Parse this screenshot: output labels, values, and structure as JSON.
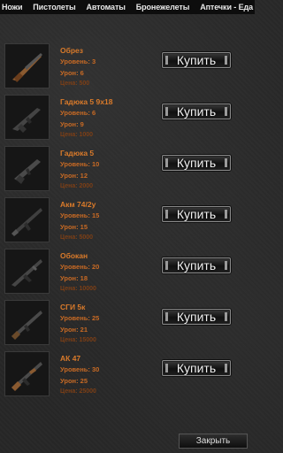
{
  "tabs": [
    "Ножи",
    "Пистолеты",
    "Автоматы",
    "Бронежелеты",
    "Аптечки - Еда"
  ],
  "buy_label": "Купить",
  "close_label": "Закрыть",
  "items": [
    {
      "name": "Обрез",
      "level": "Уровень: 3",
      "damage": "Урон: 6",
      "price": "Цена: 500"
    },
    {
      "name": "Гадюка 5 9х18",
      "level": "Уровень: 6",
      "damage": "Урон: 9",
      "price": "Цена: 1000"
    },
    {
      "name": "Гадюка 5",
      "level": "Уровень: 10",
      "damage": "Урон: 12",
      "price": "Цена: 2000"
    },
    {
      "name": "Акм 74/2у",
      "level": "Уровень: 15",
      "damage": "Урон: 15",
      "price": "Цена: 5000"
    },
    {
      "name": "Обокан",
      "level": "Уровень: 20",
      "damage": "Урон: 18",
      "price": "Цена: 10000"
    },
    {
      "name": "СГИ 5к",
      "level": "Уровень: 25",
      "damage": "Урон: 21",
      "price": "Цена: 15000"
    },
    {
      "name": "АК 47",
      "level": "Уровень: 30",
      "damage": "Урон: 25",
      "price": "Цена: 25000"
    }
  ],
  "colors": {
    "name": "#d97a2a",
    "stat": "#c86a24",
    "price": "#7d3f16"
  }
}
